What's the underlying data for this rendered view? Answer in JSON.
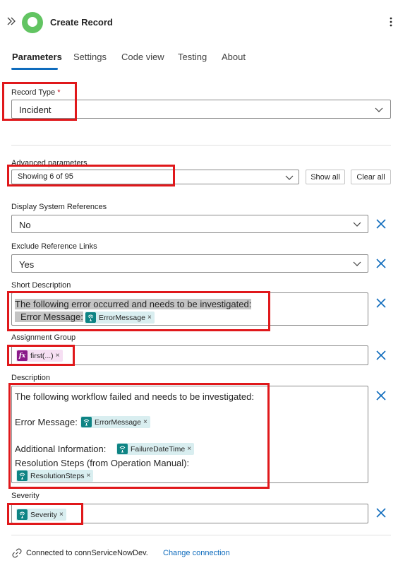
{
  "header": {
    "title": "Create Record",
    "logo_color": "#62c462"
  },
  "tabs": [
    {
      "label": "Parameters",
      "active": true
    },
    {
      "label": "Settings",
      "active": false
    },
    {
      "label": "Code view",
      "active": false
    },
    {
      "label": "Testing",
      "active": false
    },
    {
      "label": "About",
      "active": false
    }
  ],
  "record_type": {
    "label": "Record Type",
    "required_mark": "*",
    "value": "Incident"
  },
  "advanced": {
    "label": "Advanced parameters",
    "value": "Showing 6 of 95",
    "show_all": "Show all",
    "clear_all": "Clear all"
  },
  "display_system_references": {
    "label": "Display System References",
    "value": "No"
  },
  "exclude_reference_links": {
    "label": "Exclude Reference Links",
    "value": "Yes"
  },
  "short_description": {
    "label": "Short Description",
    "line1": "The following error occurred and needs to be investigated:",
    "line2": "Error Message:",
    "token": "ErrorMessage"
  },
  "assignment_group": {
    "label": "Assignment Group",
    "token": "first(...)"
  },
  "description": {
    "label": "Description",
    "line1": "The following workflow failed and needs to be investigated:",
    "error_label": "Error Message:",
    "error_token": "ErrorMessage",
    "info_label": "Additional Information:",
    "info_token": "FailureDateTime",
    "steps_label": "Resolution Steps (from Operation Manual):",
    "steps_token": "ResolutionSteps"
  },
  "severity": {
    "label": "Severity",
    "token": "Severity"
  },
  "footer": {
    "connection_text": "Connected to connServiceNowDev.",
    "change_link": "Change connection"
  },
  "colors": {
    "accent": "#0f6cbd",
    "highlight": "#e0181b",
    "token_bg": "#d9eef0",
    "token_icon": "#0e8484",
    "fx_bg": "#f6dff3",
    "fx_icon": "#8a1a8a"
  },
  "icons": {
    "expand": "double-chevron-right-icon",
    "more": "more-vertical-icon",
    "chevron": "chevron-down-icon",
    "remove": "close-icon",
    "token": "dynamic-content-icon",
    "fx": "function-icon",
    "connection": "link-icon"
  }
}
